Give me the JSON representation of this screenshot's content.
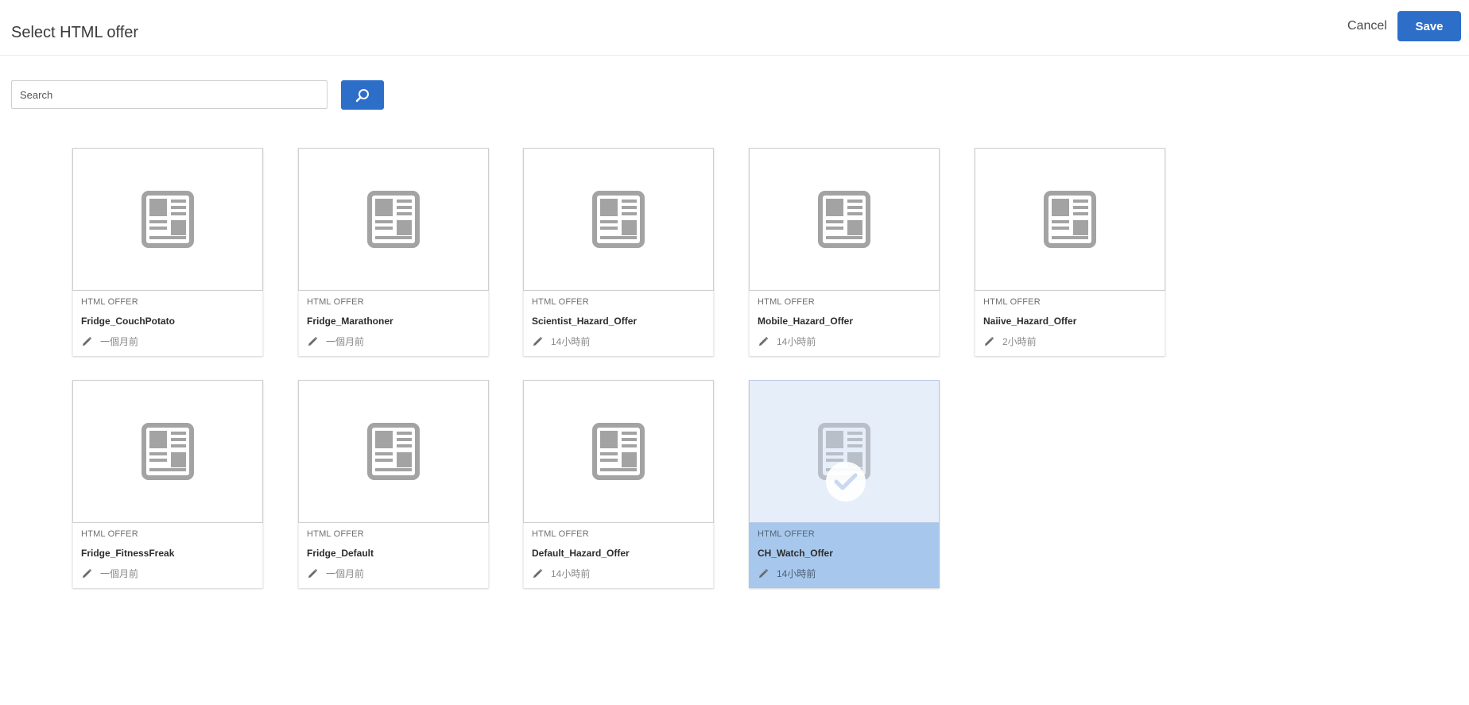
{
  "header": {
    "title": "Select HTML offer",
    "cancel_label": "Cancel",
    "save_label": "Save"
  },
  "search": {
    "placeholder": "Search",
    "value": ""
  },
  "colors": {
    "accent": "#2d6ec9",
    "selected_card": "#a7c8ec",
    "icon_gray": "#a3a3a3"
  },
  "offers": [
    {
      "type": "HTML OFFER",
      "name": "Fridge_CouchPotato",
      "modified": "一個月前",
      "selected": false,
      "thumbnail_icon": "document-layout-icon",
      "edit_icon": "pencil-icon"
    },
    {
      "type": "HTML OFFER",
      "name": "Fridge_Marathoner",
      "modified": "一個月前",
      "selected": false,
      "thumbnail_icon": "document-layout-icon",
      "edit_icon": "pencil-icon"
    },
    {
      "type": "HTML OFFER",
      "name": "Scientist_Hazard_Offer",
      "modified": "14小時前",
      "selected": false,
      "thumbnail_icon": "document-layout-icon",
      "edit_icon": "pencil-icon"
    },
    {
      "type": "HTML OFFER",
      "name": "Mobile_Hazard_Offer",
      "modified": "14小時前",
      "selected": false,
      "thumbnail_icon": "document-layout-icon",
      "edit_icon": "pencil-icon"
    },
    {
      "type": "HTML OFFER",
      "name": "Naiive_Hazard_Offer",
      "modified": "2小時前",
      "selected": false,
      "thumbnail_icon": "document-layout-icon",
      "edit_icon": "pencil-icon"
    },
    {
      "type": "HTML OFFER",
      "name": "Fridge_FitnessFreak",
      "modified": "一個月前",
      "selected": false,
      "thumbnail_icon": "document-layout-icon",
      "edit_icon": "pencil-icon"
    },
    {
      "type": "HTML OFFER",
      "name": "Fridge_Default",
      "modified": "一個月前",
      "selected": false,
      "thumbnail_icon": "document-layout-icon",
      "edit_icon": "pencil-icon"
    },
    {
      "type": "HTML OFFER",
      "name": "Default_Hazard_Offer",
      "modified": "14小時前",
      "selected": false,
      "thumbnail_icon": "document-layout-icon",
      "edit_icon": "pencil-icon"
    },
    {
      "type": "HTML OFFER",
      "name": "CH_Watch_Offer",
      "modified": "14小時前",
      "selected": true,
      "thumbnail_icon": "document-layout-icon",
      "edit_icon": "pencil-icon"
    }
  ]
}
